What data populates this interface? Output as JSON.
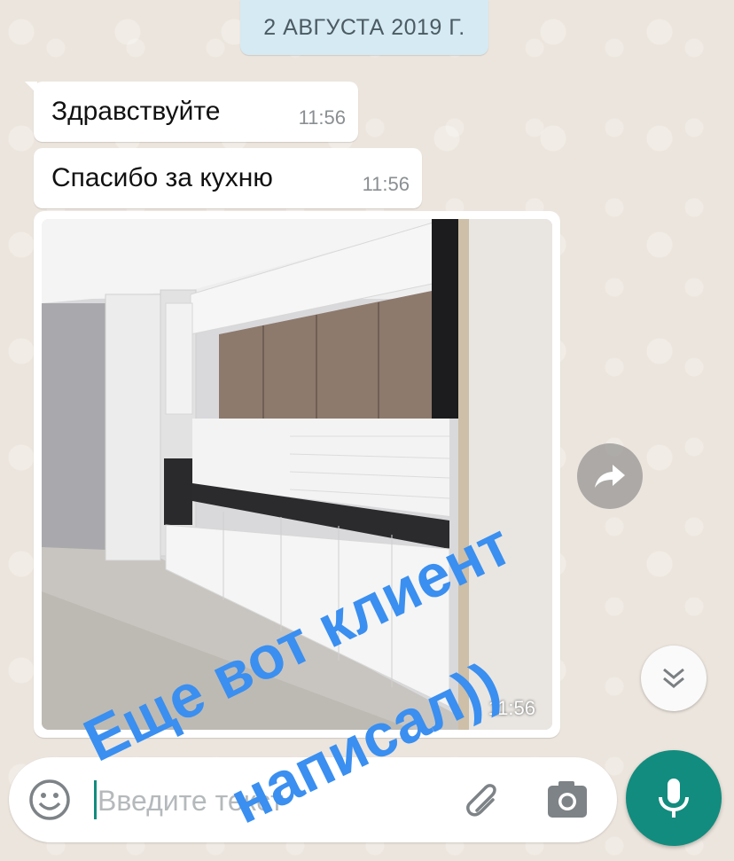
{
  "chat": {
    "date_chip": "2 АВГУСТА 2019 Г.",
    "messages": [
      {
        "text": "Здравствуйте",
        "time": "11:56"
      },
      {
        "text": "Спасибо за кухню",
        "time": "11:56"
      }
    ],
    "photo_message": {
      "time": "11:56"
    }
  },
  "input_bar": {
    "placeholder": "Введите текст"
  },
  "overlay_caption": {
    "line1": "Еще вот клиент",
    "line2": "написал))",
    "color": "#3a8ff0"
  },
  "icons": {
    "emoji": "emoji-icon",
    "attach": "paperclip-icon",
    "camera": "camera-icon",
    "mic": "microphone-icon",
    "forward": "forward-icon",
    "scroll": "double-chevron-down-icon"
  },
  "colors": {
    "accent": "#128c7e",
    "date_chip_bg": "#d5eaf3",
    "chat_bg": "#ece5dd"
  }
}
